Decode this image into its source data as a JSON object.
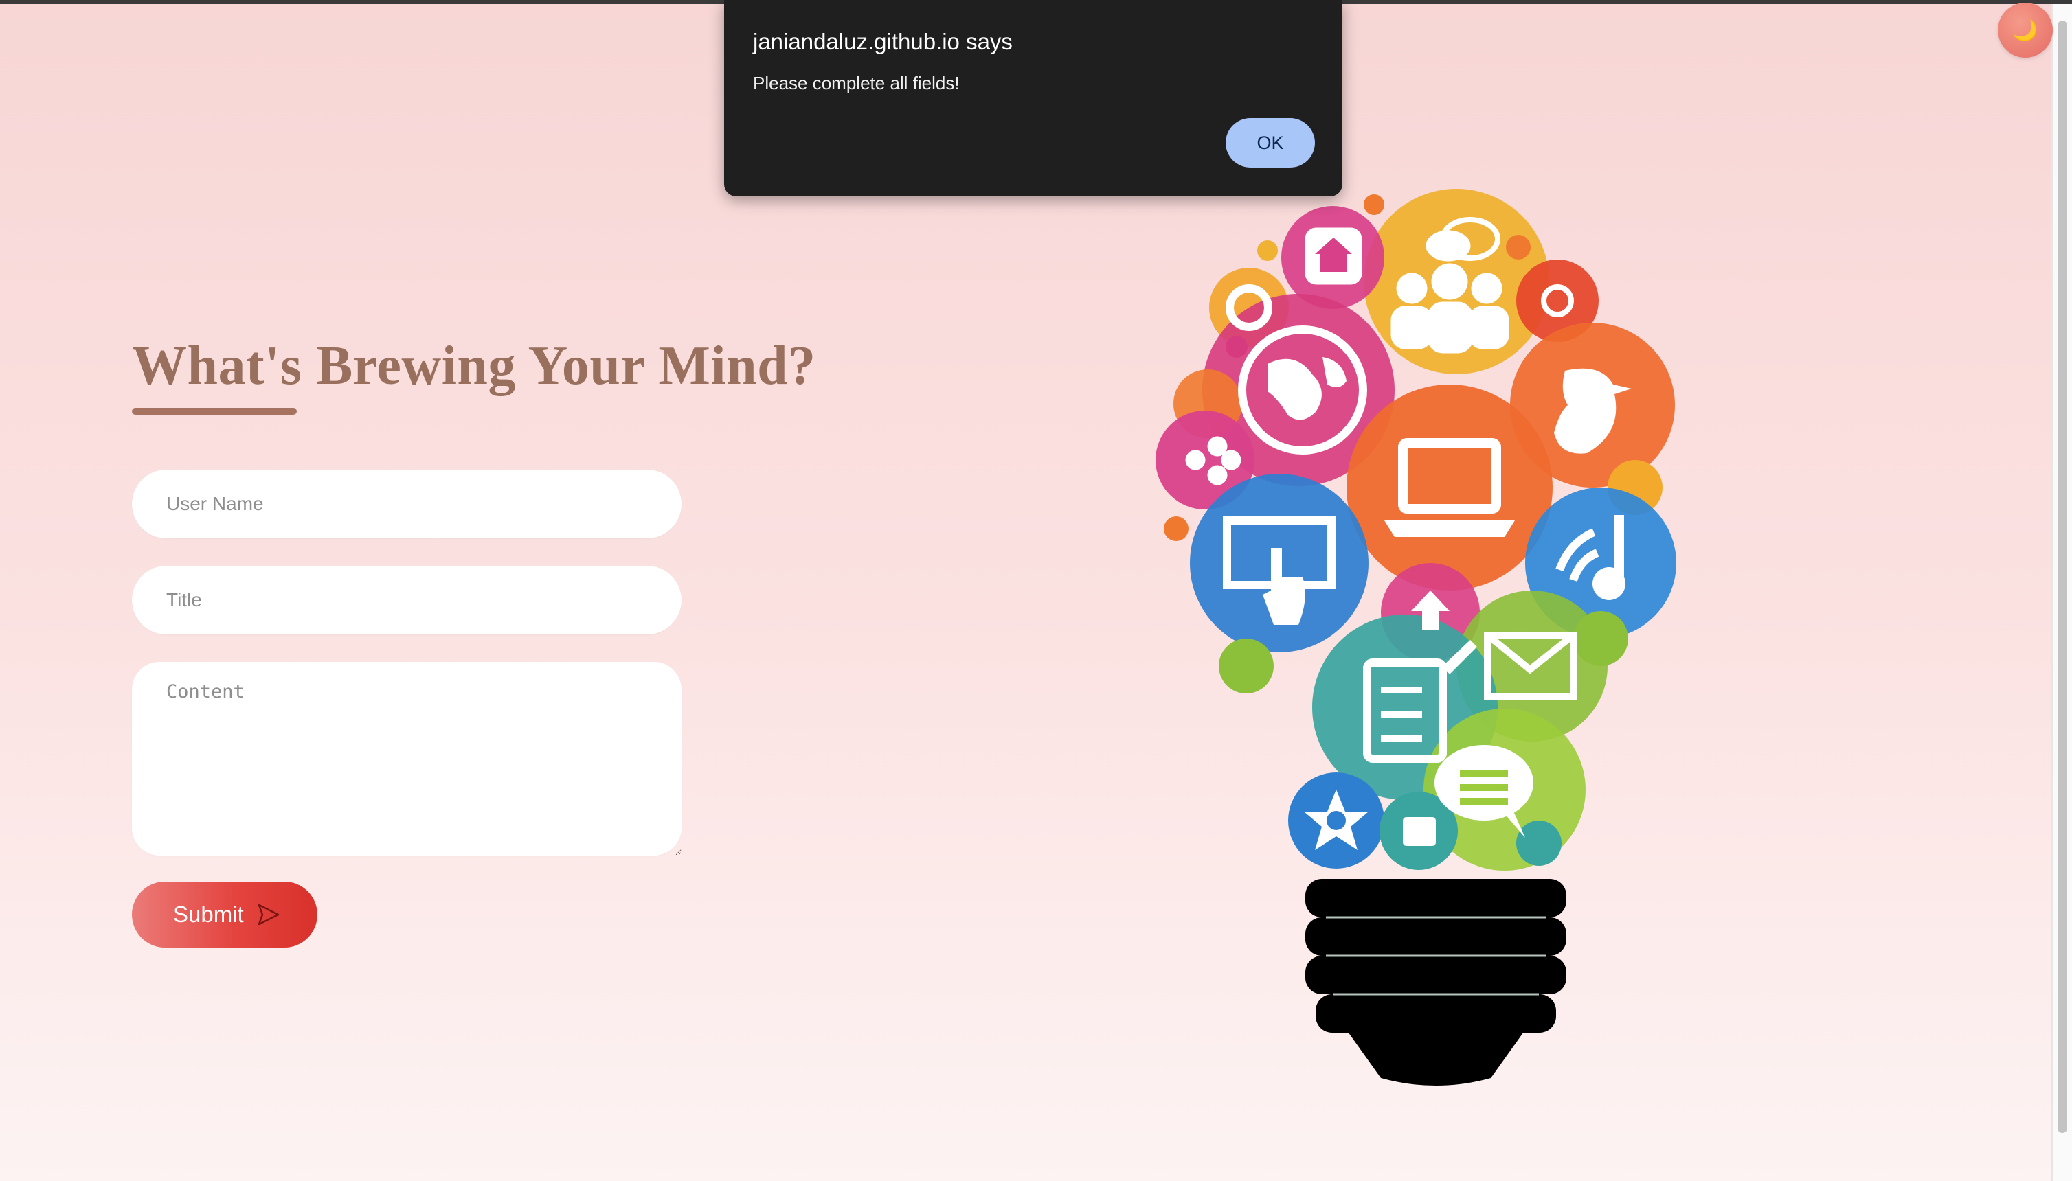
{
  "theme_toggle": {
    "icon": "moon-icon",
    "glyph": "🌙"
  },
  "form": {
    "heading": "What's Brewing Your Mind?",
    "username_placeholder": "User Name",
    "title_placeholder": "Title",
    "content_placeholder": "Content",
    "submit_label": "Submit",
    "submit_icon": "send-icon"
  },
  "dialog": {
    "title": "janiandaluz.github.io says",
    "message": "Please complete all fields!",
    "ok_label": "OK"
  },
  "illustration": {
    "name": "lightbulb-icons-illustration",
    "icons": [
      "home-icon",
      "chat-people-icon",
      "gear-icon",
      "phone-icon",
      "globe-icon",
      "bird-icon",
      "share-icon",
      "laptop-icon",
      "touchscreen-icon",
      "music-wifi-icon",
      "upload-icon",
      "mail-icon",
      "notepad-icon",
      "chat-bubble-icon",
      "star-icon",
      "shopping-bag-icon"
    ]
  },
  "colors": {
    "heading": "#98705d",
    "submit": "#e4443f",
    "dialog_bg": "#1f1f1f",
    "ok_button": "#a8c6f8"
  }
}
